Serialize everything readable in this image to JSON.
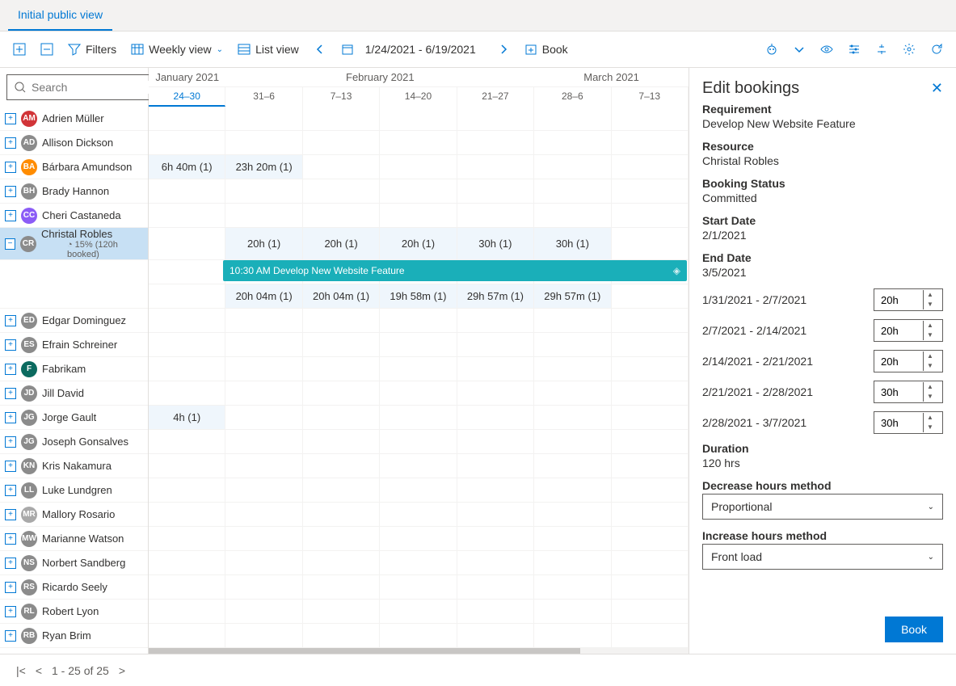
{
  "tab": "Initial public view",
  "toolbar": {
    "filters": "Filters",
    "weekly_view": "Weekly view",
    "list_view": "List view",
    "date_range": "1/24/2021 - 6/19/2021",
    "book": "Book"
  },
  "search": {
    "placeholder": "Search"
  },
  "months": [
    {
      "label": "January 2021",
      "span": 1
    },
    {
      "label": "February 2021",
      "span": 4
    },
    {
      "label": "March 2021",
      "span": 2
    }
  ],
  "weeks": [
    "24–30",
    "31–6",
    "7–13",
    "14–20",
    "21–27",
    "28–6",
    "7–13"
  ],
  "active_week_idx": 0,
  "resources": [
    {
      "name": "Adrien Müller",
      "initials": "AM",
      "color": "#d13438"
    },
    {
      "name": "Allison Dickson",
      "initials": "AD",
      "color": "#8b8b8b"
    },
    {
      "name": "Bárbara Amundson",
      "initials": "BA",
      "color": "#ff8c00",
      "cells": {
        "0": "6h 40m (1)",
        "1": "23h 20m (1)"
      }
    },
    {
      "name": "Brady Hannon",
      "initials": "BH",
      "color": "#8b8b8b"
    },
    {
      "name": "Cheri Castaneda",
      "initials": "CC",
      "color": "#8b5cf6"
    },
    {
      "name": "Christal Robles",
      "initials": "CR",
      "color": "#8b8b8b",
      "selected": true,
      "sub": "15% (120h booked)",
      "cells": {
        "1": "20h (1)",
        "2": "20h (1)",
        "3": "20h (1)",
        "4": "30h (1)",
        "5": "30h (1)"
      },
      "booking": {
        "time": "10:30 AM",
        "title": "Develop New Website Feature"
      },
      "row2": {
        "1": "20h 04m (1)",
        "2": "20h 04m (1)",
        "3": "19h 58m (1)",
        "4": "29h 57m (1)",
        "5": "29h 57m (1)"
      }
    },
    {
      "name": "Edgar Dominguez",
      "initials": "ED",
      "color": "#8b8b8b"
    },
    {
      "name": "Efrain Schreiner",
      "initials": "ES",
      "color": "#8b8b8b"
    },
    {
      "name": "Fabrikam",
      "initials": "F",
      "color": "#0b6a5f"
    },
    {
      "name": "Jill David",
      "initials": "JD",
      "color": "#8b8b8b"
    },
    {
      "name": "Jorge Gault",
      "initials": "JG",
      "color": "#8b8b8b",
      "cells": {
        "0": "4h (1)"
      }
    },
    {
      "name": "Joseph Gonsalves",
      "initials": "JG",
      "color": "#8b8b8b"
    },
    {
      "name": "Kris Nakamura",
      "initials": "KN",
      "color": "#8b8b8b"
    },
    {
      "name": "Luke Lundgren",
      "initials": "LL",
      "color": "#8b8b8b"
    },
    {
      "name": "Mallory Rosario",
      "initials": "MR",
      "color": "#a9a9a9"
    },
    {
      "name": "Marianne Watson",
      "initials": "MW",
      "color": "#8b8b8b"
    },
    {
      "name": "Norbert Sandberg",
      "initials": "NS",
      "color": "#8b8b8b"
    },
    {
      "name": "Ricardo Seely",
      "initials": "RS",
      "color": "#8b8b8b"
    },
    {
      "name": "Robert Lyon",
      "initials": "RL",
      "color": "#8b8b8b"
    },
    {
      "name": "Ryan Brim",
      "initials": "RB",
      "color": "#8b8b8b"
    }
  ],
  "panel": {
    "title": "Edit bookings",
    "requirement_label": "Requirement",
    "requirement": "Develop New Website Feature",
    "resource_label": "Resource",
    "resource": "Christal Robles",
    "status_label": "Booking Status",
    "status": "Committed",
    "start_label": "Start Date",
    "start": "2/1/2021",
    "end_label": "End Date",
    "end": "3/5/2021",
    "weeks": [
      {
        "range": "1/31/2021 - 2/7/2021",
        "hours": "20h"
      },
      {
        "range": "2/7/2021 - 2/14/2021",
        "hours": "20h"
      },
      {
        "range": "2/14/2021 - 2/21/2021",
        "hours": "20h"
      },
      {
        "range": "2/21/2021 - 2/28/2021",
        "hours": "30h"
      },
      {
        "range": "2/28/2021 - 3/7/2021",
        "hours": "30h"
      }
    ],
    "duration_label": "Duration",
    "duration": "120 hrs",
    "decrease_label": "Decrease hours method",
    "decrease": "Proportional",
    "increase_label": "Increase hours method",
    "increase": "Front load",
    "book": "Book"
  },
  "footer": {
    "range": "1 - 25 of 25"
  }
}
